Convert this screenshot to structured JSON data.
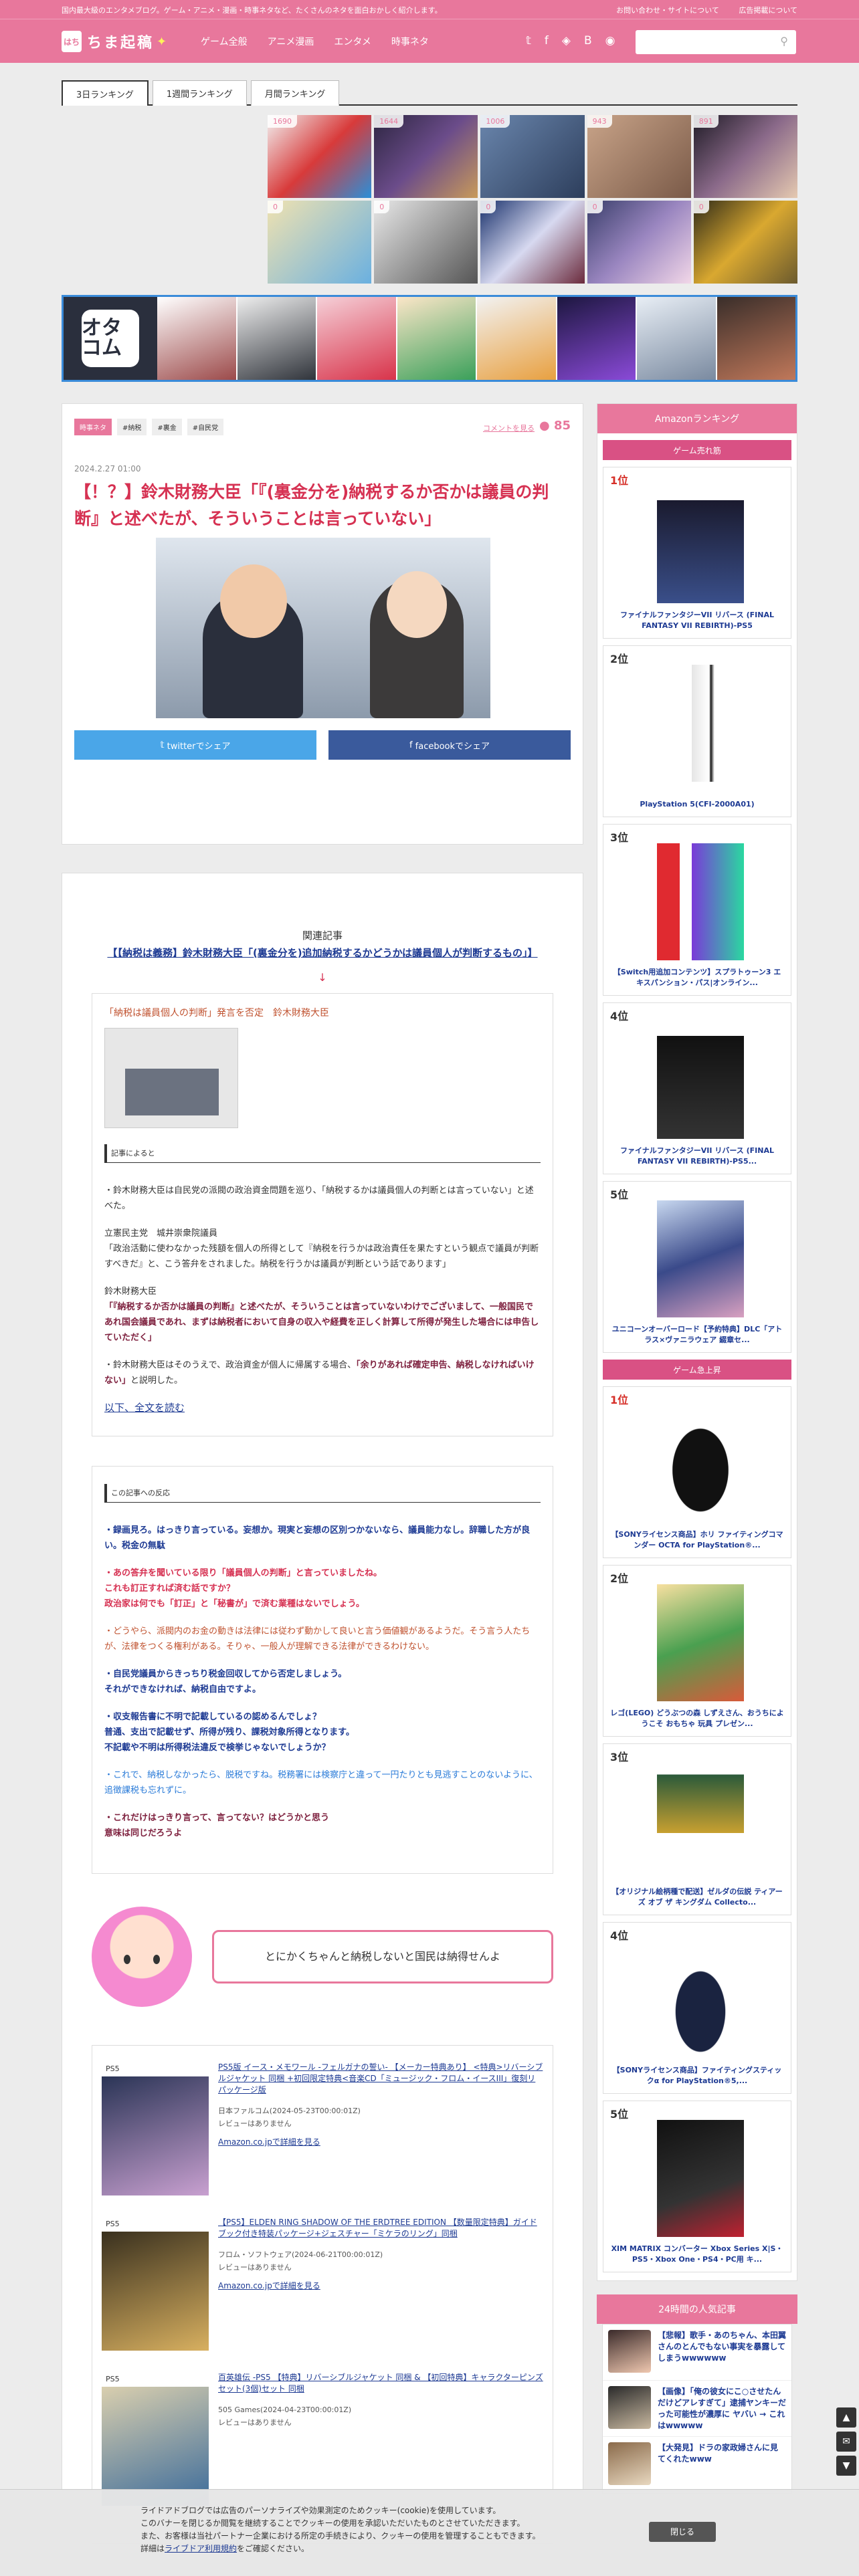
{
  "topbar": {
    "tagline": "国内最大級のエンタメブログ。ゲーム・アニメ・漫画・時事ネタなど、たくさんのネタを面白おかしく紹介します。",
    "contact": "お問い合わせ・サイトについて",
    "ads": "広告掲載について"
  },
  "header": {
    "logo_box": "はち",
    "logo_text": "ちま起稿",
    "nav": [
      "ゲーム全般",
      "アニメ漫画",
      "エンタメ",
      "時事ネタ"
    ],
    "search_placeholder": ""
  },
  "tabs": [
    "3日ランキング",
    "1週間ランキング",
    "月間ランキング"
  ],
  "ranking_counts": [
    "1690",
    "1644",
    "1006",
    "943",
    "891",
    "0",
    "0",
    "0",
    "0",
    "0"
  ],
  "banner_logo": "オタコム",
  "article": {
    "categories": [
      "時事ネタ",
      "#納税",
      "#裏金",
      "#自民党"
    ],
    "comment_link": "コメントを見る",
    "comment_count": "85",
    "date": "2024.2.27 01:00",
    "title": "【！？】鈴木財務大臣「『(裏金分を)納税するか否かは議員の判断』と述べたが、そういうことは言っていない」",
    "share_twitter": "twitterでシェア",
    "share_facebook": "facebookでシェア",
    "related_title": "関連記事",
    "related_link": "【【納税は義務】鈴木財務大臣「(裏金分を)追加納税するかどうかは議員個人が判断するもの」】",
    "arrow": "↓",
    "quote_title": "「納税は議員個人の判断」発言を否定　鈴木財務大臣",
    "section_source": "記事によると",
    "p1": "・鈴木財務大臣は自民党の派閥の政治資金問題を巡り、「納税するかは議員個人の判断とは言っていない」と述べた。",
    "p2a": "立憲民主党　城井崇衆院議員",
    "p2b": "「政治活動に使わなかった残額を個人の所得として『納税を行うかは政治責任を果たすという観点で議員が判断すべきだ』と、こう答弁をされました。納税を行うかは議員が判断という話であります」",
    "p3a": "鈴木財務大臣",
    "p3b": "「『納税するか否かは議員の判断』と述べたが、そういうことは言っていないわけでございまして、一般国民であれ国会議員であれ、まずは納税者において自身の収入や経費を正しく計算して所得が発生した場合には申告していただく」",
    "p4a": "・鈴木財務大臣はそのうえで、政治資金が個人に帰属する場合、",
    "p4b": "「余りがあれば確定申告、納税しなければいけない」",
    "p4c": "と説明した。",
    "read_more": "以下、全文を読む",
    "section_reaction": "この記事への反応",
    "r1": "・録画見ろ。はっきり言っている。妄想か。現実と妄想の区別つかないなら、議員能力なし。辞職した方が良い。税金の無駄",
    "r2a": "・あの答弁を聞いている限り「議員個人の判断」と言っていましたね。",
    "r2b": "これも訂正すれば済む話ですか？",
    "r2c": "政治家は何でも「訂正」と「秘書が」で済む業種はないでしょう。",
    "r3": "・どうやら、派閥内のお金の動きは法律には従わず動かして良いと言う価値観があるようだ。そう言う人たちが、法律をつくる権利がある。そりゃ、一般人が理解できる法律ができるわけない。",
    "r4a": "・自民党議員からきっちり税金回収してから否定しましょう。",
    "r4b": "それができなければ、納税自由ですよ。",
    "r5a": "・収支報告書に不明で記載しているの認めるんでしょ？",
    "r5b": "普通、支出で記載せず、所得が残り、課税対象所得となります。",
    "r5c": "不記載や不明は所得税法違反で検挙じゃないでしょうか？",
    "r6": "・これで、納税しなかったら、脱税ですね。税務署には検察庁と違って一円たりとも見逃すことのないように、追徴課税も忘れずに。",
    "r7a": "・これだけはっきり言って、言ってない？はどうかと思う",
    "r7b": "意味は同じだろうよ",
    "chara_comment": "とにかくちゃんと納税しないと国民は納得せんよ"
  },
  "products": [
    {
      "platform": "PS5",
      "title": "PS5版 イース・メモワール -フェルガナの誓い- 【メーカー特典あり】 <特典>リバーシブルジャケット 同梱 +初回限定特典<音楽CD「ミュージック・フロム・イースIII」復刻リパッケージ版",
      "meta1": "日本ファルコム(2024-05-23T00:00:01Z)",
      "meta2": "レビューはありません",
      "cta": "Amazon.co.jpで詳細を見る"
    },
    {
      "platform": "PS5",
      "title": "【PS5】ELDEN RING SHADOW OF THE ERDTREE EDITION 【数量限定特典】ガイドブック付き特装パッケージ+ジェスチャー「ミケラのリング」同梱",
      "meta1": "フロム・ソフトウェア(2024-06-21T00:00:01Z)",
      "meta2": "レビューはありません",
      "cta": "Amazon.co.jpで詳細を見る"
    },
    {
      "platform": "PS5",
      "title": "百英雄伝 -PS5 【特典】リバーシブルジャケット 同梱 & 【初回特典】キャラクターピンズセット(3個)セット 同梱",
      "meta1": "505 Games(2024-04-23T00:00:01Z)",
      "meta2": "レビューはありません",
      "cta": ""
    }
  ],
  "sidebar": {
    "amazon_title": "Amazonランキング",
    "sub1": "ゲーム売れ筋",
    "sub2": "ゲーム急上昇",
    "popular_title": "24時間の人気記事",
    "bestsellers": [
      {
        "rank": "1位",
        "title": "ファイナルファンタジーVII リバース (FINAL FANTASY VII REBIRTH)-PS5"
      },
      {
        "rank": "2位",
        "title": "PlayStation 5(CFI-2000A01)"
      },
      {
        "rank": "3位",
        "title": "【Switch用追加コンテンツ】スプラトゥーン3 エキスパンション・パス|オンライン..."
      },
      {
        "rank": "4位",
        "title": "ファイナルファンタジーVII リバース (FINAL FANTASY VII REBIRTH)-PS5..."
      },
      {
        "rank": "5位",
        "title": "ユニコーンオーバーロード【予約特典】DLC「アトラス×ヴァニラウェア 綴章セ..."
      }
    ],
    "rising": [
      {
        "rank": "1位",
        "title": "【SONYライセンス商品】ホリ ファイティングコマンダー OCTA for PlayStation®..."
      },
      {
        "rank": "2位",
        "title": "レゴ(LEGO) どうぶつの森 しずえさん、おうちにようこそ おもちゃ 玩具 プレゼン..."
      },
      {
        "rank": "3位",
        "title": "【オリジナル絵柄種で配送】ゼルダの伝説 ティアーズ オブ ザ キングダム Collecto..."
      },
      {
        "rank": "4位",
        "title": "【SONYライセンス商品】ファイティングスティックα for PlayStation®5,..."
      },
      {
        "rank": "5位",
        "title": "XIM MATRIX コンバーター Xbox Series X|S・PS5・Xbox One・PS4・PC用 キ..."
      }
    ],
    "popular": [
      "【悲報】歌手・あのちゃん、本田翼さんのとんでもない事実を暴露してしまうwwwwww",
      "【画像】「俺の彼女にこ○させたんだけどアレすぎて」逮捕ヤンキーだった可能性が濃厚に ヤバい → これはwwwww",
      "【大発見】ドラの家政婦さんに見てくれたwww"
    ]
  },
  "cookie": {
    "line1": "ライドアドブログでは広告のパーソナライズや効果測定のためクッキー(cookie)を使用しています。",
    "line2": "このバナーを閉じるか閲覧を継続することでクッキーの使用を承認いただいたものとさせていただきます。",
    "line3": "また、お客様は当社パートナー企業における所定の手続きにより、クッキーの使用を管理することもできます。",
    "line4a": "詳細は",
    "line4link": "ライブドア利用規約",
    "line4b": "をご確認ください。",
    "close": "閉じる"
  },
  "colors": {
    "brand_pink": "#e8779c",
    "title_red": "#d63152",
    "link_blue": "#1d3a93",
    "twitter": "#4aa6e8",
    "facebook": "#3a5a9c"
  },
  "icons": [
    "twitter-icon",
    "facebook-icon",
    "feedly-icon",
    "hatena-icon",
    "rss-icon",
    "search-icon"
  ]
}
